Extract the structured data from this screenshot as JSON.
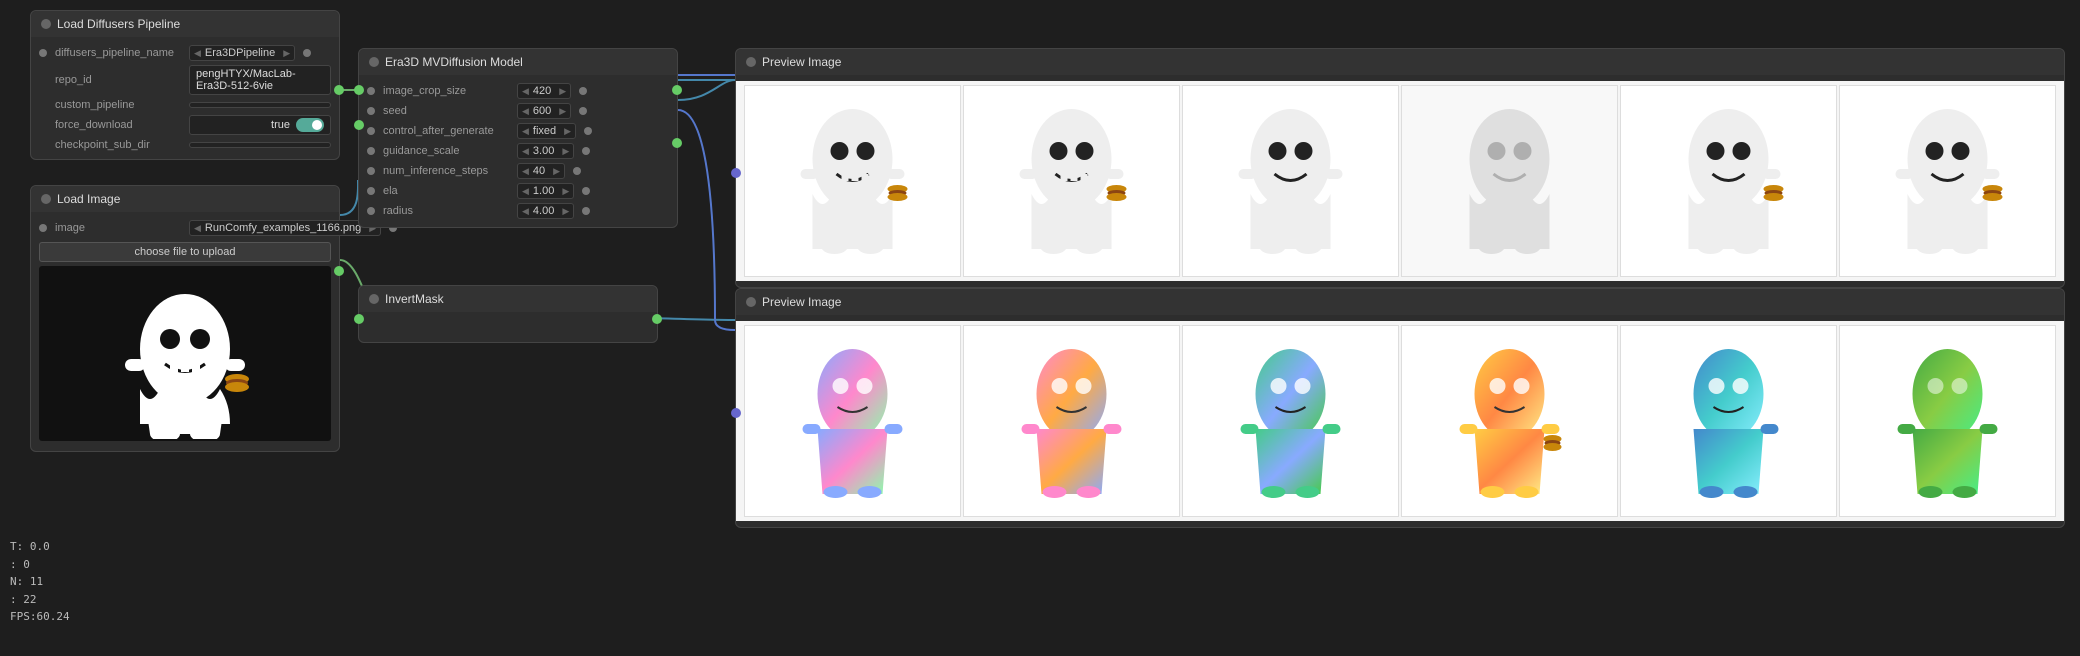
{
  "nodes": {
    "diffusersPipeline": {
      "title": "Load Diffusers Pipeline",
      "fields": [
        {
          "label": "diffusers_pipeline_name",
          "value": "Era3DPipeline",
          "hasArrows": true
        },
        {
          "label": "repo_id",
          "value": "pengHTYX/MacLab-Era3D-512-6vie",
          "hasArrows": false
        },
        {
          "label": "custom_pipeline",
          "value": "",
          "hasArrows": false
        },
        {
          "label": "force_download",
          "value": "true",
          "hasArrows": false,
          "hasToggle": true
        },
        {
          "label": "checkpoint_sub_dir",
          "value": "",
          "hasArrows": false
        }
      ]
    },
    "loadImage": {
      "title": "Load Image",
      "imageField": {
        "label": "image",
        "value": "RunComfy_examples_1166.png",
        "hasArrows": true
      },
      "chooseBtn": "choose file to upload"
    },
    "era3dModel": {
      "title": "Era3D MVDiffusion Model",
      "params": [
        {
          "label": "image_crop_size",
          "value": "420"
        },
        {
          "label": "seed",
          "value": "600"
        },
        {
          "label": "control_after_generate",
          "value": "fixed"
        },
        {
          "label": "guidance_scale",
          "value": "3.00"
        },
        {
          "label": "num_inference_steps",
          "value": "40"
        },
        {
          "label": "ela",
          "value": "1.00"
        },
        {
          "label": "radius",
          "value": "4.00"
        }
      ]
    },
    "invertMask": {
      "title": "InvertMask"
    },
    "previewImageTop": {
      "title": "Preview Image",
      "imageCount": 6
    },
    "previewImageBottom": {
      "title": "Preview Image",
      "imageCount": 6
    }
  },
  "stats": {
    "t": "T: 0.0",
    "unknown1": ": 0",
    "n": "N: 11",
    "unknown2": ": 22",
    "fps": "FPS:60.24"
  },
  "colors": {
    "nodeBackground": "#2d2d2d",
    "nodeHeader": "#333333",
    "connectionGreen": "#6aaa6a",
    "connectionBlue": "#5577cc",
    "connectionYellow": "#aaaa44",
    "previewBackground": "#f0f0f0"
  }
}
